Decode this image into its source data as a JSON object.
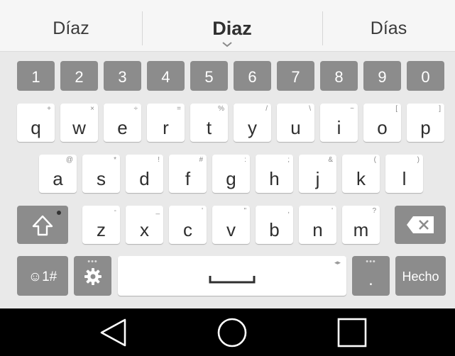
{
  "suggestions": {
    "left": "Díaz",
    "center": "Diaz",
    "right": "Días"
  },
  "number_row": [
    "1",
    "2",
    "3",
    "4",
    "5",
    "6",
    "7",
    "8",
    "9",
    "0"
  ],
  "row1": [
    {
      "l": "q",
      "h": "+"
    },
    {
      "l": "w",
      "h": "×"
    },
    {
      "l": "e",
      "h": "÷"
    },
    {
      "l": "r",
      "h": "="
    },
    {
      "l": "t",
      "h": "%"
    },
    {
      "l": "y",
      "h": "/"
    },
    {
      "l": "u",
      "h": "\\"
    },
    {
      "l": "i",
      "h": "~"
    },
    {
      "l": "o",
      "h": "["
    },
    {
      "l": "p",
      "h": "]"
    }
  ],
  "row2": [
    {
      "l": "a",
      "h": "@"
    },
    {
      "l": "s",
      "h": "*"
    },
    {
      "l": "d",
      "h": "!"
    },
    {
      "l": "f",
      "h": "#"
    },
    {
      "l": "g",
      "h": ":"
    },
    {
      "l": "h",
      "h": ";"
    },
    {
      "l": "j",
      "h": "&"
    },
    {
      "l": "k",
      "h": "("
    },
    {
      "l": "l",
      "h": ")"
    }
  ],
  "row3": [
    {
      "l": "z",
      "h": "-"
    },
    {
      "l": "x",
      "h": "_"
    },
    {
      "l": "c",
      "h": "'"
    },
    {
      "l": "v",
      "h": "\""
    },
    {
      "l": "b",
      "h": ","
    },
    {
      "l": "n",
      "h": "'"
    },
    {
      "l": "m",
      "h": "?"
    }
  ],
  "bottom": {
    "symbols": "☺1#",
    "period": ".",
    "done": "Hecho"
  },
  "icons": {
    "shift": "shift-icon",
    "backspace": "backspace-icon",
    "settings": "gear-icon",
    "space": "space-bar-icon",
    "back": "back-triangle-icon",
    "home": "home-circle-icon",
    "recents": "recents-square-icon"
  },
  "colors": {
    "dark_key": "#8c8c8c",
    "key": "#ffffff",
    "keyboard_bg": "#e9e9e9",
    "nav_bg": "#000000"
  }
}
